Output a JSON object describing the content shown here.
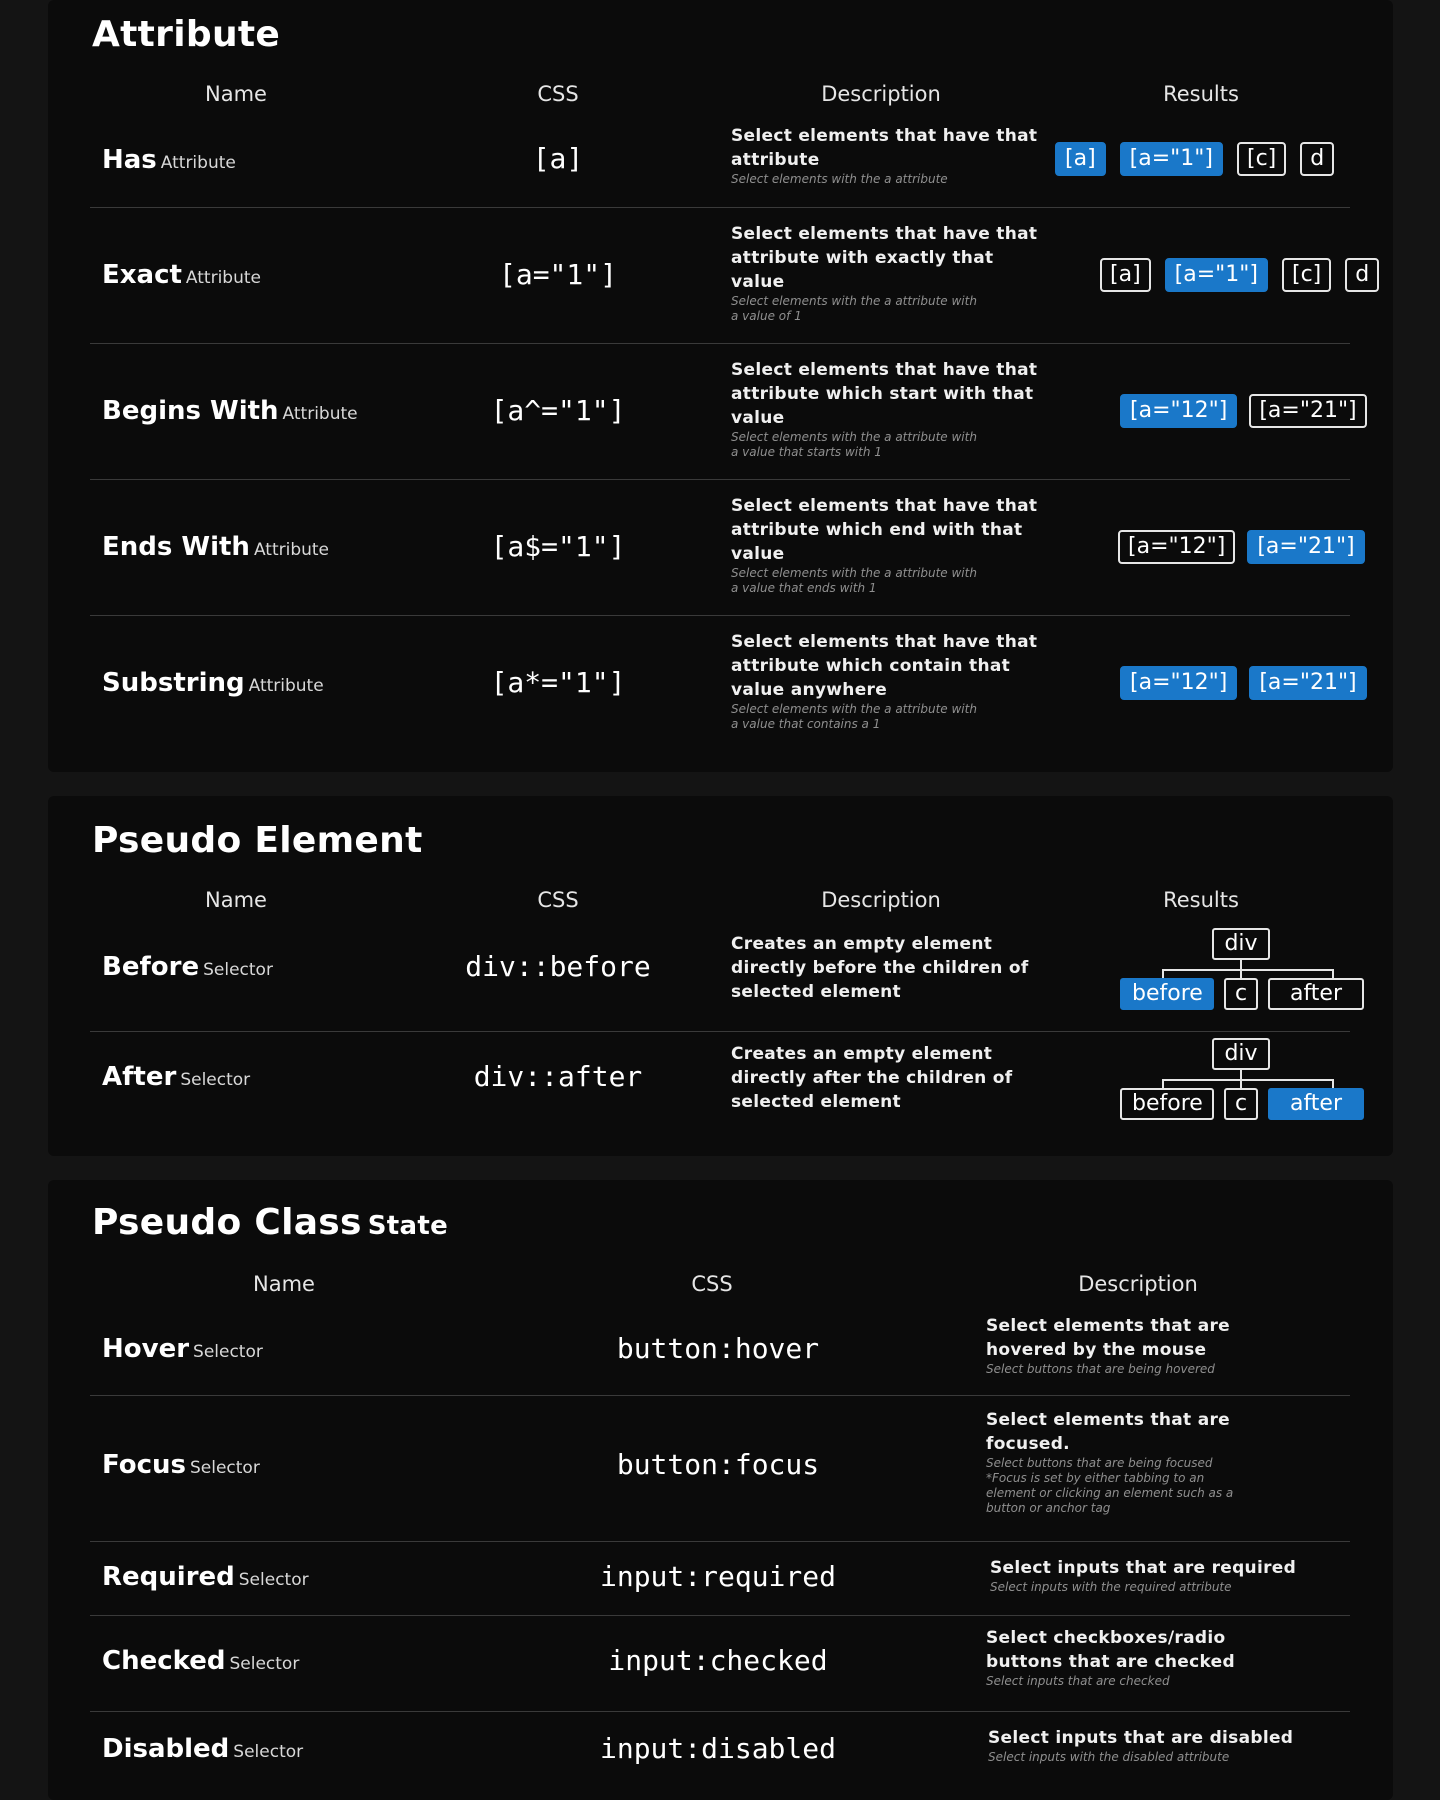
{
  "attribute": {
    "title": "Attribute",
    "headers": {
      "name": "Name",
      "css": "CSS",
      "description": "Description",
      "results": "Results"
    },
    "rows": [
      {
        "name": "Has",
        "name_sub": "Attribute",
        "css": "[a]",
        "desc_main": [
          "Select elements that have that",
          "attribute"
        ],
        "desc_fine": [
          "Select elements with the a attribute"
        ],
        "results": [
          {
            "label": "[a]",
            "selected": true
          },
          {
            "label": "[a=\"1\"]",
            "selected": true
          },
          {
            "label": "[c]",
            "selected": false
          },
          {
            "label": "d",
            "selected": false
          }
        ]
      },
      {
        "name": "Exact",
        "name_sub": "Attribute",
        "css": "[a=\"1\"]",
        "desc_main": [
          "Select elements that have that",
          "attribute with exactly that",
          "value"
        ],
        "desc_fine": [
          "Select elements with the a attribute with",
          "a value of 1"
        ],
        "results": [
          {
            "label": "[a]",
            "selected": false
          },
          {
            "label": "[a=\"1\"]",
            "selected": true
          },
          {
            "label": "[c]",
            "selected": false
          },
          {
            "label": "d",
            "selected": false
          }
        ]
      },
      {
        "name": "Begins With",
        "name_sub": "Attribute",
        "css": "[a^=\"1\"]",
        "desc_main": [
          "Select elements that have that",
          "attribute which start with that",
          "value"
        ],
        "desc_fine": [
          "Select elements with the a attribute with",
          "a value that starts with 1"
        ],
        "results": [
          {
            "label": "[a=\"12\"]",
            "selected": true
          },
          {
            "label": "[a=\"21\"]",
            "selected": false
          }
        ]
      },
      {
        "name": "Ends With",
        "name_sub": "Attribute",
        "css": "[a$=\"1\"]",
        "desc_main": [
          "Select elements that have that",
          "attribute which end with that",
          "value"
        ],
        "desc_fine": [
          "Select elements with the a attribute with",
          "a value that ends with 1"
        ],
        "results": [
          {
            "label": "[a=\"12\"]",
            "selected": false
          },
          {
            "label": "[a=\"21\"]",
            "selected": true
          }
        ]
      },
      {
        "name": "Substring",
        "name_sub": "Attribute",
        "css": "[a*=\"1\"]",
        "desc_main": [
          "Select elements that have that",
          "attribute which contain that",
          "value anywhere"
        ],
        "desc_fine": [
          "Select elements with the a attribute with",
          "a value that contains a 1"
        ],
        "results": [
          {
            "label": "[a=\"12\"]",
            "selected": true
          },
          {
            "label": "[a=\"21\"]",
            "selected": true
          }
        ]
      }
    ]
  },
  "pseudo_element": {
    "title": "Pseudo Element",
    "headers": {
      "name": "Name",
      "css": "CSS",
      "description": "Description",
      "results": "Results"
    },
    "rows": [
      {
        "name": "Before",
        "name_sub": "Selector",
        "css": "div::before",
        "desc_main": [
          "Creates an empty element",
          "directly before the children of",
          "selected element"
        ],
        "tree": {
          "root": "div",
          "left": "before",
          "mid": "c",
          "right": "after",
          "selected": "left"
        }
      },
      {
        "name": "After",
        "name_sub": "Selector",
        "css": "div::after",
        "desc_main": [
          "Creates an empty element",
          "directly after the children of",
          "selected element"
        ],
        "tree": {
          "root": "div",
          "left": "before",
          "mid": "c",
          "right": "after",
          "selected": "right"
        }
      }
    ]
  },
  "pseudo_class": {
    "title": "Pseudo Class",
    "title_sub": "State",
    "headers": {
      "name": "Name",
      "css": "CSS",
      "description": "Description"
    },
    "rows": [
      {
        "name": "Hover",
        "name_sub": "Selector",
        "css": "button:hover",
        "desc_main": [
          "Select elements that are",
          "hovered by the mouse"
        ],
        "desc_fine": [
          "Select buttons that are being hovered"
        ]
      },
      {
        "name": "Focus",
        "name_sub": "Selector",
        "css": "button:focus",
        "desc_main": [
          "Select elements that are",
          "focused."
        ],
        "desc_fine": [
          "Select buttons that are being focused",
          "*Focus is set by either tabbing to an",
          "element or clicking an element such as a",
          "button or anchor tag"
        ]
      },
      {
        "name": "Required",
        "name_sub": "Selector",
        "css": "input:required",
        "desc_main": [
          "Select inputs that are required"
        ],
        "desc_fine": [
          "Select inputs with the required attribute"
        ]
      },
      {
        "name": "Checked",
        "name_sub": "Selector",
        "css": "input:checked",
        "desc_main": [
          "Select checkboxes/radio",
          "buttons that are checked"
        ],
        "desc_fine": [
          "Select inputs that are checked"
        ]
      },
      {
        "name": "Disabled",
        "name_sub": "Selector",
        "css": "input:disabled",
        "desc_main": [
          "Select inputs that are disabled"
        ],
        "desc_fine": [
          "Select inputs with the disabled attribute"
        ]
      }
    ]
  },
  "colors": {
    "selected_chip": "#1a78c9",
    "card_bg": "#0b0b0b",
    "page_bg": "#141414"
  }
}
